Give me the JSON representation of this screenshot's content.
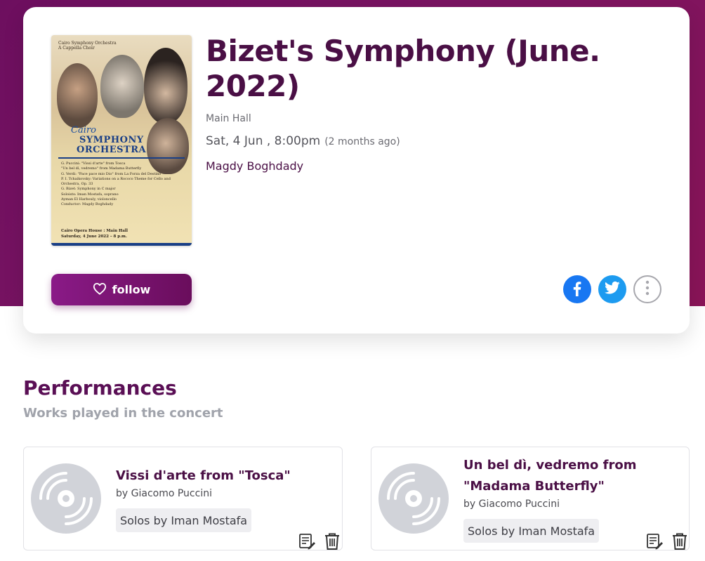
{
  "event": {
    "title": "Bizet's Symphony (June. 2022)",
    "venue": "Main Hall",
    "date": "Sat, 4 Jun , 8:00pm",
    "relative_time": "(2 months ago)",
    "conductor": "Magdy Boghdady"
  },
  "poster": {
    "header_line1": "Cairo Symphony Orchestra",
    "header_line2": "A Cappella Choir",
    "title_line1": "Cairo",
    "title_line2": "SYMPHONY",
    "title_line3": "ORCHESTRA",
    "program": [
      "G. Puccini: \"Vissi d'arte\" from Tosca",
      "\"Un bel dì, vedremo\" from Madama Butterfly",
      "G. Verdi: \"Pace pace mio Dio\" from La Forza del Destino",
      "P. I. Tchaikovsky: Variations on a Rococo Theme for Cello and Orchestra, Op. 33",
      "G. Bizet: Symphony in C major",
      "Soloists: Iman Mostafa, soprano",
      "Ayman El Harbouly, violoncello",
      "Conductor: Magdy Boghdady"
    ],
    "footer_line1": "Cairo Opera House : Main Hall",
    "footer_line2": "Saturday, 4 June 2022 – 8 p.m."
  },
  "actions": {
    "follow_label": "follow"
  },
  "section": {
    "title": "Performances",
    "subtitle": "Works played in the concert"
  },
  "performances": [
    {
      "title": "Vissi d'arte from \"Tosca\"",
      "composer": "by Giacomo Puccini",
      "solos": "Solos by Iman Mostafa"
    },
    {
      "title": "Un bel dì, vedremo from \"Madama Butterfly\"",
      "composer": "by Giacomo Puccini",
      "solos": "Solos by Iman Mostafa"
    }
  ],
  "colors": {
    "brand": "#6d0f5f",
    "title": "#4a0f45",
    "facebook": "#1877f2",
    "twitter": "#1d9bf0"
  },
  "icons": [
    "heart-icon",
    "facebook-icon",
    "twitter-icon",
    "more-vertical-icon",
    "vinyl-disc-icon",
    "edit-list-icon",
    "trash-icon"
  ]
}
